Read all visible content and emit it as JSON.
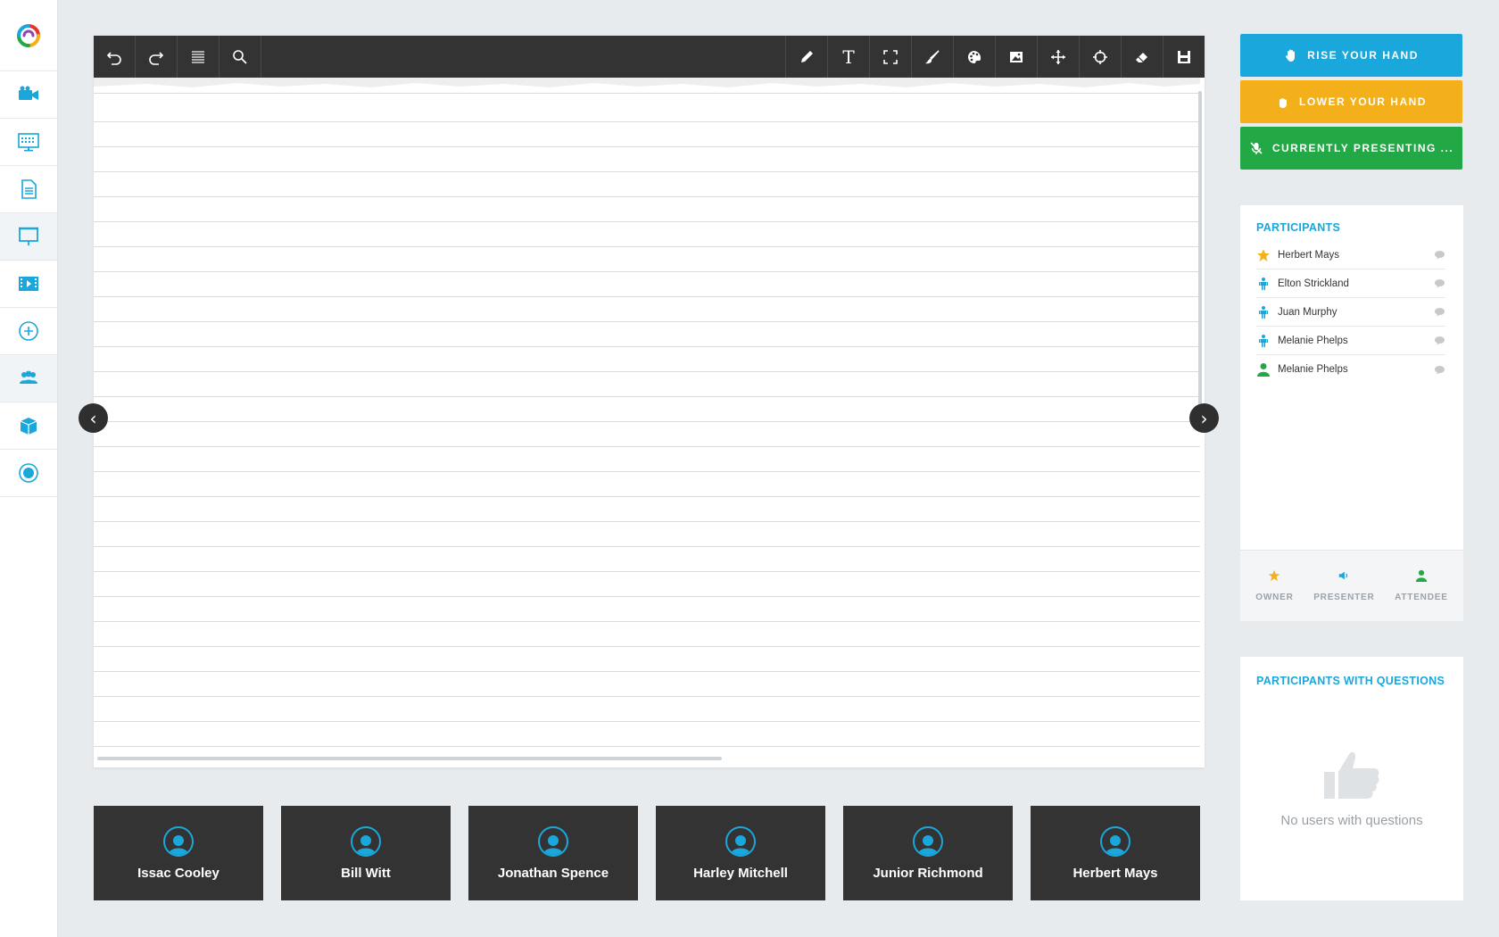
{
  "sidebar": {
    "items": [
      {
        "icon": "video-camera-icon",
        "label": ""
      },
      {
        "icon": "keyboard-screen-icon",
        "label": ""
      },
      {
        "icon": "document-icon",
        "label": ""
      },
      {
        "icon": "presentation-screen-icon",
        "label": ""
      },
      {
        "icon": "film-icon",
        "label": ""
      },
      {
        "icon": "add-circle-icon",
        "label": ""
      },
      {
        "icon": "users-icon",
        "label": ""
      },
      {
        "icon": "package-box-icon",
        "label": ""
      },
      {
        "icon": "record-icon",
        "label": ""
      }
    ]
  },
  "toolbar": {
    "left": [
      "undo-icon",
      "redo-icon",
      "lines-icon",
      "search-icon"
    ],
    "right": [
      "pencil-icon",
      "text-icon",
      "fullscreen-icon",
      "brush-icon",
      "palette-icon",
      "image-icon",
      "move-icon",
      "crosshair-icon",
      "eraser-icon",
      "save-icon"
    ],
    "text_glyph": "T"
  },
  "board": {
    "prev_glyph": "‹",
    "next_glyph": "›"
  },
  "tiles": [
    {
      "name": "Issac Cooley"
    },
    {
      "name": "Bill Witt"
    },
    {
      "name": "Jonathan Spence"
    },
    {
      "name": "Harley Mitchell"
    },
    {
      "name": "Junior Richmond"
    },
    {
      "name": "Herbert Mays"
    }
  ],
  "actions": {
    "rise": "RISE YOUR HAND",
    "lower": "LOWER YOUR HAND",
    "presenting": "CURRENTLY PRESENTING ..."
  },
  "participants": {
    "title": "PARTICIPANTS",
    "list": [
      {
        "name": "Herbert Mays",
        "role": "owner"
      },
      {
        "name": "Elton Strickland",
        "role": "presenter"
      },
      {
        "name": "Juan Murphy",
        "role": "presenter"
      },
      {
        "name": "Melanie Phelps",
        "role": "presenter"
      },
      {
        "name": "Melanie Phelps",
        "role": "attendee"
      }
    ],
    "legend": {
      "owner": "OWNER",
      "presenter": "PRESENTER",
      "attendee": "ATTENDEE"
    }
  },
  "questions": {
    "title": "PARTICIPANTS WITH QUESTIONS",
    "empty": "No users with questions"
  },
  "colors": {
    "accent": "#1aa7dc",
    "yellow": "#f4b01b",
    "green": "#22a845",
    "dark": "#333333"
  }
}
